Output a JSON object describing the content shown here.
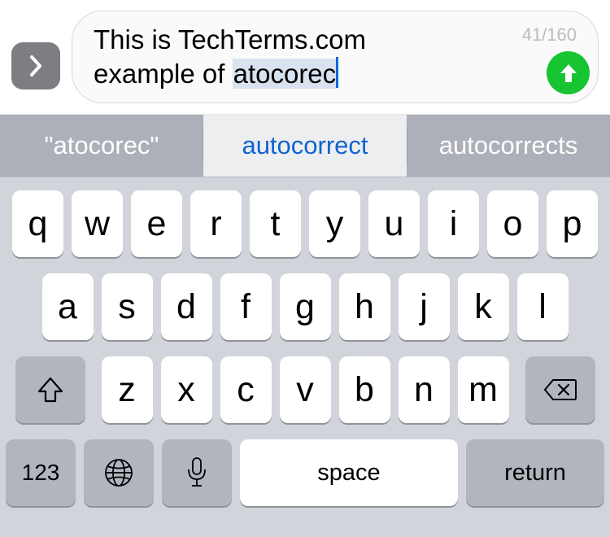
{
  "compose": {
    "line1": "This is TechTerms.com",
    "line2_prefix": "example of ",
    "highlighted_word": "atocorec",
    "counter": "41/160"
  },
  "suggestions": {
    "left": "\"atocorec\"",
    "middle": "autocorrect",
    "right": "autocorrects"
  },
  "keys": {
    "row1": [
      "q",
      "w",
      "e",
      "r",
      "t",
      "y",
      "u",
      "i",
      "o",
      "p"
    ],
    "row2": [
      "a",
      "s",
      "d",
      "f",
      "g",
      "h",
      "j",
      "k",
      "l"
    ],
    "row3": [
      "z",
      "x",
      "c",
      "v",
      "b",
      "n",
      "m"
    ],
    "numbers": "123",
    "space": "space",
    "return": "return"
  }
}
